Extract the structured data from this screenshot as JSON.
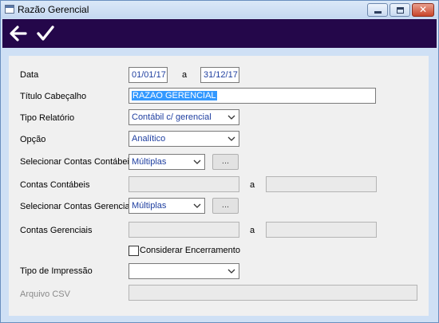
{
  "window": {
    "title": "Razão Gerencial"
  },
  "toolbar": {
    "back_icon": "back-arrow-icon",
    "confirm_icon": "checkmark-icon"
  },
  "form": {
    "data": {
      "label": "Data",
      "from": "01/01/17",
      "sep": "a",
      "to": "31/12/17"
    },
    "titulo": {
      "label": "Título Cabeçalho",
      "value": "RAZAO GERENCIAL"
    },
    "tipo_relatorio": {
      "label": "Tipo Relatório",
      "value": "Contábil c/ gerencial"
    },
    "opcao": {
      "label": "Opção",
      "value": "Analítico"
    },
    "sel_contas_contabeis": {
      "label": "Selecionar Contas Contábeis",
      "value": "Múltiplas",
      "button": "..."
    },
    "contas_contabeis": {
      "label": "Contas Contábeis",
      "sep": "a",
      "from": "",
      "to": ""
    },
    "sel_contas_gerenciais": {
      "label": "Selecionar Contas Gerenciais",
      "value": "Múltiplas",
      "button": "..."
    },
    "contas_gerenciais": {
      "label": "Contas Gerenciais",
      "sep": "a",
      "from": "",
      "to": ""
    },
    "considerar_encerramento": {
      "label": "Considerar Encerramento",
      "checked": false
    },
    "tipo_impressao": {
      "label": "Tipo de Impressão",
      "value": ""
    },
    "arquivo_csv": {
      "label": "Arquivo CSV",
      "value": ""
    }
  },
  "colors": {
    "toolbar_bg": "#24074a",
    "field_text": "#1f3fa0",
    "selection": "#3399ff"
  }
}
